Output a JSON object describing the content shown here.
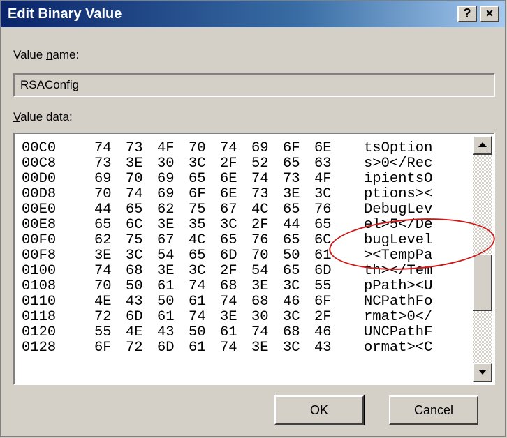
{
  "window": {
    "title": "Edit Binary Value",
    "help_btn": "?",
    "close_btn": "×"
  },
  "value_name": {
    "label_pre": "Value ",
    "label_key": "n",
    "label_post": "ame:",
    "value": "RSAConfig"
  },
  "value_data": {
    "label_key": "V",
    "label_post": "alue data:",
    "rows": [
      {
        "addr": "00C0",
        "bytes": [
          "74",
          "73",
          "4F",
          "70",
          "74",
          "69",
          "6F",
          "6E"
        ],
        "ascii": "tsOption"
      },
      {
        "addr": "00C8",
        "bytes": [
          "73",
          "3E",
          "30",
          "3C",
          "2F",
          "52",
          "65",
          "63"
        ],
        "ascii": "s>0</Rec"
      },
      {
        "addr": "00D0",
        "bytes": [
          "69",
          "70",
          "69",
          "65",
          "6E",
          "74",
          "73",
          "4F"
        ],
        "ascii": "ipientsO"
      },
      {
        "addr": "00D8",
        "bytes": [
          "70",
          "74",
          "69",
          "6F",
          "6E",
          "73",
          "3E",
          "3C"
        ],
        "ascii": "ptions><"
      },
      {
        "addr": "00E0",
        "bytes": [
          "44",
          "65",
          "62",
          "75",
          "67",
          "4C",
          "65",
          "76"
        ],
        "ascii": "DebugLev"
      },
      {
        "addr": "00E8",
        "bytes": [
          "65",
          "6C",
          "3E",
          "35",
          "3C",
          "2F",
          "44",
          "65"
        ],
        "ascii": "el>5</De"
      },
      {
        "addr": "00F0",
        "bytes": [
          "62",
          "75",
          "67",
          "4C",
          "65",
          "76",
          "65",
          "6C"
        ],
        "ascii": "bugLevel"
      },
      {
        "addr": "00F8",
        "bytes": [
          "3E",
          "3C",
          "54",
          "65",
          "6D",
          "70",
          "50",
          "61"
        ],
        "ascii": "><TempPa"
      },
      {
        "addr": "0100",
        "bytes": [
          "74",
          "68",
          "3E",
          "3C",
          "2F",
          "54",
          "65",
          "6D"
        ],
        "ascii": "th></Tem"
      },
      {
        "addr": "0108",
        "bytes": [
          "70",
          "50",
          "61",
          "74",
          "68",
          "3E",
          "3C",
          "55"
        ],
        "ascii": "pPath><U"
      },
      {
        "addr": "0110",
        "bytes": [
          "4E",
          "43",
          "50",
          "61",
          "74",
          "68",
          "46",
          "6F"
        ],
        "ascii": "NCPathFo"
      },
      {
        "addr": "0118",
        "bytes": [
          "72",
          "6D",
          "61",
          "74",
          "3E",
          "30",
          "3C",
          "2F"
        ],
        "ascii": "rmat>0</"
      },
      {
        "addr": "0120",
        "bytes": [
          "55",
          "4E",
          "43",
          "50",
          "61",
          "74",
          "68",
          "46"
        ],
        "ascii": "UNCPathF"
      },
      {
        "addr": "0128",
        "bytes": [
          "6F",
          "72",
          "6D",
          "61",
          "74",
          "3E",
          "3C",
          "43"
        ],
        "ascii": "ormat><C"
      }
    ]
  },
  "buttons": {
    "ok": "OK",
    "cancel": "Cancel"
  },
  "colors": {
    "title_start": "#0a246a",
    "title_end": "#a6caf0",
    "annotation": "#d01818",
    "face": "#d4d0c8"
  }
}
